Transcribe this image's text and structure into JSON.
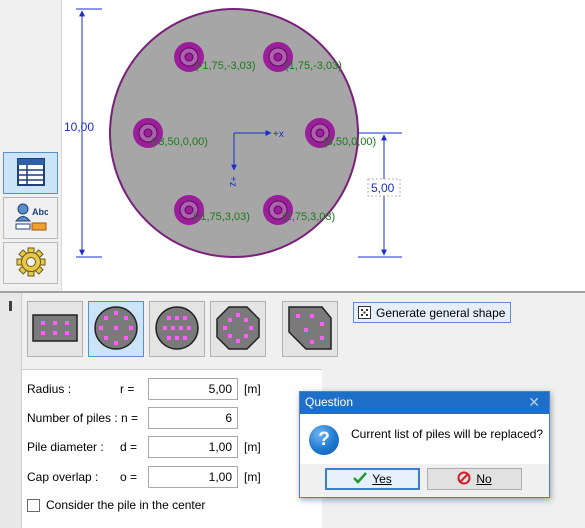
{
  "sidebar": {
    "items": [
      {
        "name": "table-view",
        "icon": "table-icon",
        "active": true
      },
      {
        "name": "labels",
        "icon": "labels-abc-icon",
        "active": false
      },
      {
        "name": "settings",
        "icon": "gear-icon",
        "active": false
      }
    ]
  },
  "canvas": {
    "dims": {
      "diameter": "10,00",
      "radius": "5,00"
    },
    "axis_x_label": "+x",
    "axis_z_label": "+z",
    "piles": [
      {
        "label": "(-1,75,-3,03)"
      },
      {
        "label": "(1,75,-3,03)"
      },
      {
        "label": "(-3,50,0,00)"
      },
      {
        "label": "(3,50,0,00)"
      },
      {
        "label": "(-1,75,3,03)"
      },
      {
        "label": "(1,75,3,03)"
      }
    ],
    "colors": {
      "cap_fill": "#a6a6a6",
      "cap_outline": "#7a1f7a",
      "pile": "#9b1e9b",
      "dimension": "#1a2ecc",
      "label": "#1a7a1a"
    }
  },
  "panel": {
    "shapes": [
      {
        "name": "rectangle-shape",
        "active": false
      },
      {
        "name": "circle-perimeter-shape",
        "active": true
      },
      {
        "name": "circle-grid-shape",
        "active": false
      },
      {
        "name": "octagon-shape",
        "active": false
      },
      {
        "name": "general-shape",
        "active": false
      }
    ],
    "generate_label": "Generate general shape",
    "params": {
      "radius": {
        "label": "Radius :",
        "symbol": "r =",
        "value": "5,00",
        "unit": "[m]"
      },
      "piles": {
        "label": "Number of piles : n =",
        "symbol": "",
        "value": "6",
        "unit": ""
      },
      "diameter": {
        "label": "Pile diameter :",
        "symbol": "d =",
        "value": "1,00",
        "unit": "[m]"
      },
      "overlap": {
        "label": "Cap overlap :",
        "symbol": "o =",
        "value": "1,00",
        "unit": "[m]"
      }
    },
    "center_pile_label": "Consider the pile in the center",
    "center_pile_checked": false
  },
  "dialog": {
    "title": "Question",
    "close_glyph": "✕",
    "icon_glyph": "?",
    "message": "Current list of piles will be replaced?",
    "yes_label": "Yes",
    "no_label": "No"
  }
}
